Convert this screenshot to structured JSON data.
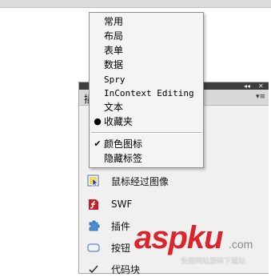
{
  "panel": {
    "tab_label": "插",
    "collapse_glyph": "◂◂",
    "close_glyph": "✕",
    "menu_glyph": "▾≡",
    "items": [
      {
        "label": "鼠标经过图像",
        "icon": "rollover-image-icon"
      },
      {
        "label": "SWF",
        "icon": "swf-icon"
      },
      {
        "label": "插件",
        "icon": "plugin-icon"
      },
      {
        "label": "按钮",
        "icon": "button-icon"
      },
      {
        "label": "代码块",
        "icon": "code-icon"
      }
    ]
  },
  "menu": {
    "items": [
      {
        "label": "常用",
        "checked": false,
        "selected": false
      },
      {
        "label": "布局",
        "checked": false,
        "selected": false
      },
      {
        "label": "表单",
        "checked": false,
        "selected": false
      },
      {
        "label": "数据",
        "checked": false,
        "selected": false
      },
      {
        "label": "Spry",
        "checked": false,
        "selected": false
      },
      {
        "label": "InContext Editing",
        "checked": false,
        "selected": false
      },
      {
        "label": "文本",
        "checked": false,
        "selected": false
      },
      {
        "label": "收藏夹",
        "checked": false,
        "selected": true
      }
    ],
    "options": [
      {
        "label": "颜色图标",
        "checked": true
      },
      {
        "label": "隐藏标签",
        "checked": false
      }
    ],
    "check_glyph": "✔",
    "bullet_glyph": "●"
  },
  "watermark": {
    "logo": "aspku",
    "domain": ".com",
    "subtitle": "免费网站源码下载站"
  }
}
